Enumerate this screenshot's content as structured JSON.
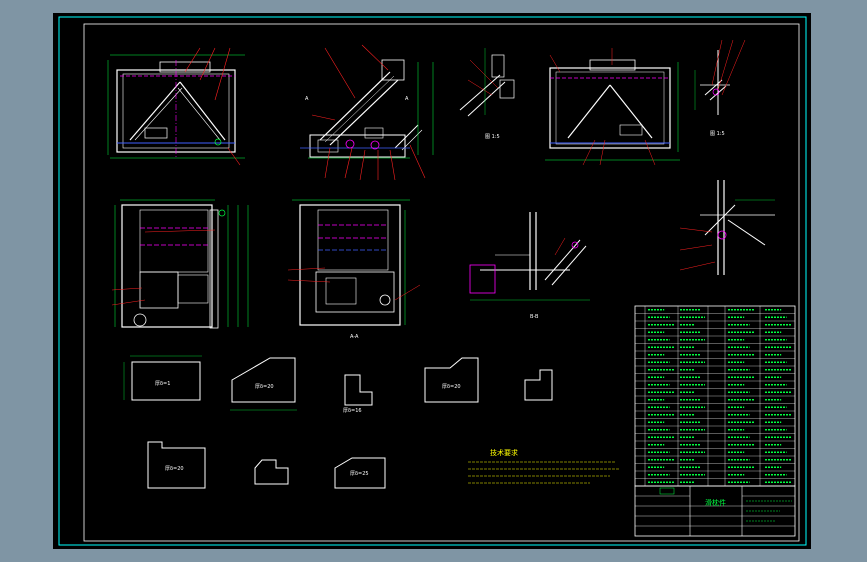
{
  "colors": {
    "background": "#7f95a4",
    "sheet": "#000000",
    "frame": "#00ffff",
    "outline": "#ffffff",
    "accent_magenta": "#ff00ff",
    "leader_red": "#ff2020",
    "dim_green": "#00ff40",
    "yellow": "#ffff00",
    "blue": "#4060ff"
  },
  "icons": [
    "frame-icon"
  ],
  "views": [
    {
      "name": "front-view"
    },
    {
      "name": "side-view"
    },
    {
      "name": "rear-view"
    },
    {
      "name": "plan-view"
    },
    {
      "name": "section-view"
    },
    {
      "name": "bracket-detail"
    }
  ],
  "plates": [
    {
      "label": "厚δ=1"
    },
    {
      "label": "厚δ=20"
    },
    {
      "label": "厚δ=16"
    },
    {
      "label": "厚δ=20"
    },
    {
      "label": "厚δ=20"
    },
    {
      "label": "厚δ=25"
    }
  ],
  "tech_notes": {
    "title": "技术要求"
  },
  "title_block": {
    "assembly_name": "滑枕件"
  }
}
